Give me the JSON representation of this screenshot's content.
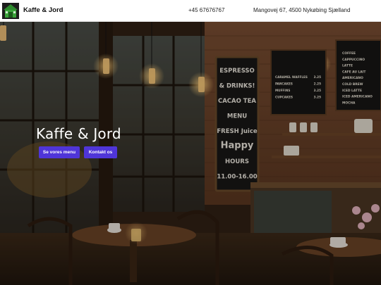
{
  "header": {
    "brand": "Kaffe & Jord",
    "phone": "+45 67676767",
    "address": "Mangovej 67, 4500 Nykøbing Sjælland",
    "logo_icon": "cafe-house-logo-icon"
  },
  "hero": {
    "title": "Kaffe & Jord",
    "menu_button": "Se vores menu",
    "contact_button": "Kontakt os",
    "button_color": "#4f35d8"
  },
  "chalkboard_center": {
    "lines": [
      "ESPRESSO",
      "& DRINKS!",
      "CACAO TEA",
      "MENU",
      "FRESH Juice",
      "Happy",
      "HOURS",
      "11.00-16.00"
    ]
  },
  "chalkboard_left_menu": {
    "items": [
      {
        "name": "CARAMEL WAFFLES",
        "price": "3.25"
      },
      {
        "name": "PANCAKES",
        "price": "2.25"
      },
      {
        "name": "MUFFINS",
        "price": "3.25"
      },
      {
        "name": "CUPCAKES",
        "price": "3.25"
      }
    ]
  },
  "chalkboard_right_menu": {
    "items": [
      "COFFEE",
      "CAPPUCCINO",
      "LATTE",
      "CAFE AU LAIT",
      "AMERICANO",
      "COLD BREW",
      "ICED LATTE",
      "ICED AMERICANO",
      "MOCHA"
    ]
  }
}
